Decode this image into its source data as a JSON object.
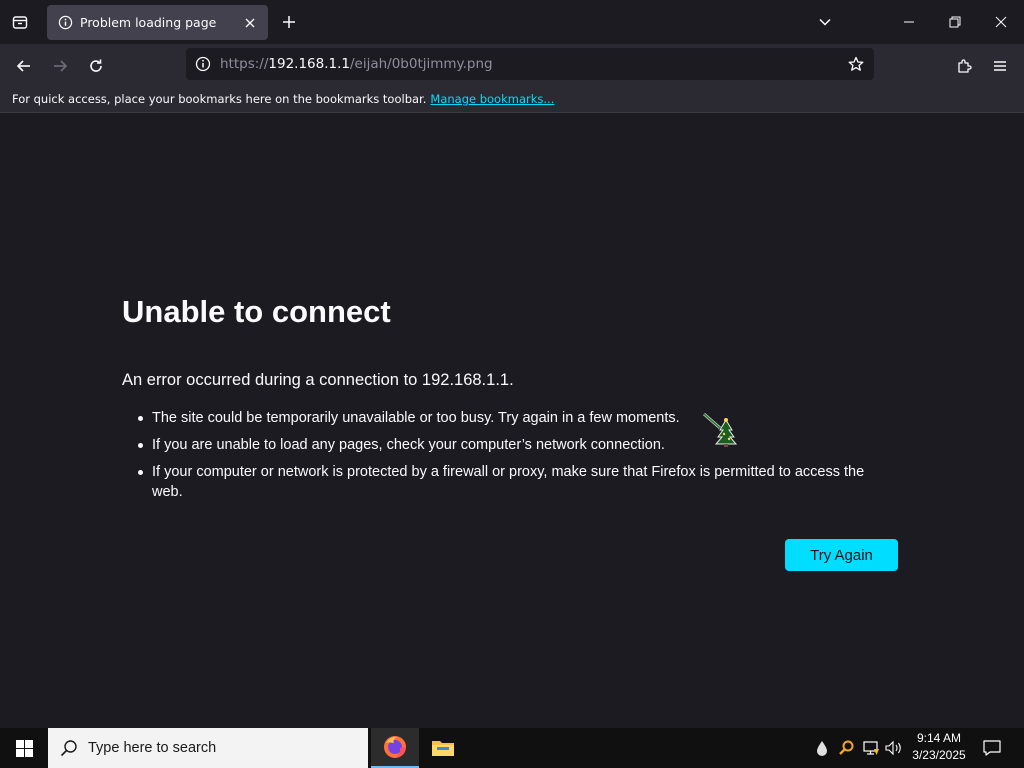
{
  "tab": {
    "title": "Problem loading page"
  },
  "urlbar": {
    "scheme": "https://",
    "host": "192.168.1.1",
    "path": "/eijah/0b0tjimmy.png"
  },
  "bookmarks_toolbar": {
    "message": "For quick access, place your bookmarks here on the bookmarks toolbar.",
    "manage_link": "Manage bookmarks..."
  },
  "error_page": {
    "title": "Unable to connect",
    "description": "An error occurred during a connection to 192.168.1.1.",
    "bullets": [
      "The site could be temporarily unavailable or too busy. Try again in a few moments.",
      "If you are unable to load any pages, check your computer’s network connection.",
      "If your computer or network is protected by a firewall or proxy, make sure that Firefox is permitted to access the web."
    ],
    "try_again_label": "Try Again"
  },
  "taskbar": {
    "search_placeholder": "Type here to search",
    "apps": [
      "firefox-icon",
      "file-explorer-icon"
    ],
    "clock_time": "9:14 AM",
    "clock_date": "3/23/2025"
  },
  "colors": {
    "accent": "#00ddff",
    "page_bg": "#1c1b22",
    "toolbar_bg": "#2b2a33",
    "active_tab_bg": "#42414d"
  }
}
